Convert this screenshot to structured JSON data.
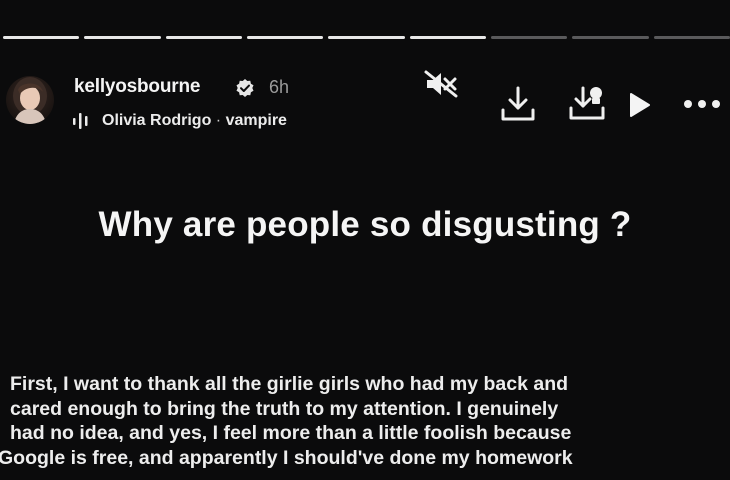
{
  "story": {
    "progress_segments": [
      {
        "state": "done"
      },
      {
        "state": "done"
      },
      {
        "state": "done"
      },
      {
        "state": "done"
      },
      {
        "state": "done"
      },
      {
        "state": "done"
      },
      {
        "state": "pending"
      },
      {
        "state": "pending"
      },
      {
        "state": "pending"
      }
    ],
    "progress_fraction": 0.67
  },
  "header": {
    "username": "kellyosbourne",
    "verified_icon": "verified-badge-icon",
    "time_ago": "6h",
    "music": {
      "icon": "audio-bars-icon",
      "artist": "Olivia Rodrigo",
      "separator": "·",
      "song": "vampire"
    },
    "actions": {
      "mute_icon": "speaker-muted-icon",
      "download_icon": "download-icon",
      "save_icon": "save-to-device-icon",
      "play_icon": "play-icon",
      "more_icon": "more-dots-icon"
    }
  },
  "post": {
    "headline": "Why are people so disgusting ?",
    "body_lines": [
      "First, I want to thank all the girlie girls who had my back and",
      "cared enough to bring the truth to my attention. I genuinely",
      "had no idea, and yes, I feel more than a little foolish because",
      "Google is free, and apparently I should've done my homework"
    ]
  },
  "colors": {
    "background": "#0b0b0c",
    "text_primary": "#f2f2f2",
    "text_secondary": "#9b9b9b",
    "progress_done": "#e8e8e8",
    "progress_pending": "#5a5a5c"
  }
}
